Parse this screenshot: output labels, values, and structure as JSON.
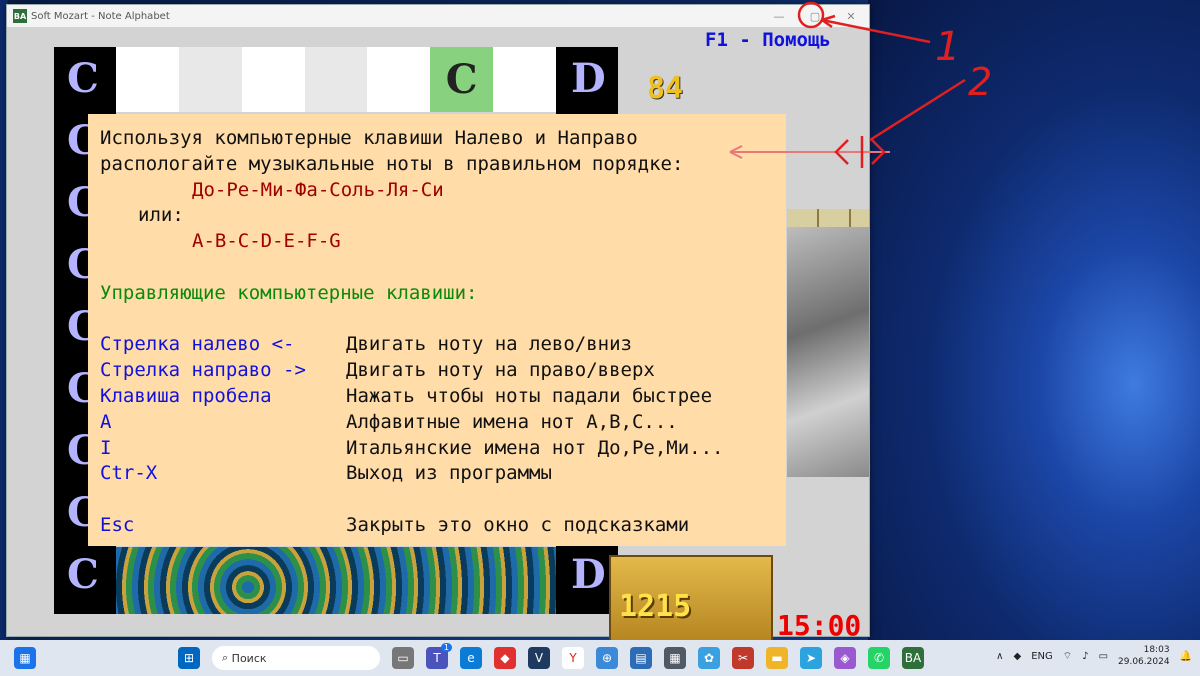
{
  "window": {
    "title": "Soft Mozart - Note Alphabet",
    "app_icon_text": "BA",
    "minimize": "—",
    "maximize": "▢",
    "close": "✕"
  },
  "help_key": "F1 - Помощь",
  "board": {
    "left_letters": [
      "C",
      "C",
      "C",
      "C",
      "C",
      "C",
      "C",
      "C",
      "C"
    ],
    "right_letters": [
      "D",
      "D"
    ],
    "active_note": "C",
    "score": "84",
    "chest_value": "1215",
    "timer": "15:00"
  },
  "panel": {
    "intro1": "Используя компьютерные клавиши Налево и Направо",
    "intro2": "распологайте музыкальные ноты в правильном порядке:",
    "sequence_ru": "До-Ре-Ми-Фа-Соль-Ля-Си",
    "or": "или:",
    "sequence_en": "A-B-C-D-E-F-G",
    "keys_heading": "Управляющие компьютерные клавиши:",
    "keys": [
      {
        "key": "Стрелка налево <-",
        "action": "Двигать ноту на лево/вниз"
      },
      {
        "key": "Стрелка направо ->",
        "action": "Двигать ноту на право/вверх"
      },
      {
        "key": "Клавиша пробела",
        "action": "Нажать чтобы ноты падали быстрее"
      },
      {
        "key": "A",
        "action": "Алфавитные имена нот A,B,C..."
      },
      {
        "key": "I",
        "action": "Итальянские имена нот До,Ре,Ми..."
      },
      {
        "key": "Ctr-X",
        "action": "Выход из программы"
      }
    ],
    "esc_key": "Esc",
    "esc_action": "Закрыть это окно с подсказками"
  },
  "annotations": {
    "label1": "1",
    "label2": "2",
    "color": "#e02020"
  },
  "taskbar": {
    "search_placeholder": "Поиск",
    "language": "ENG",
    "time": "18:03",
    "date": "29.06.2024",
    "badge_count": "1"
  }
}
